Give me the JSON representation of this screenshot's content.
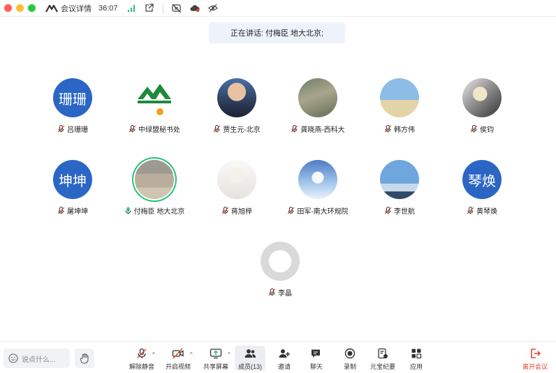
{
  "titlebar": {
    "title": "会议详情",
    "time": "36:07"
  },
  "speaking": "正在讲话: 付梅臣 地大北京;",
  "participants": [
    {
      "name": "吕珊珊",
      "avatar": "text",
      "avatar_text": "珊珊"
    },
    {
      "name": "中绿盟秘书处",
      "avatar": "logo"
    },
    {
      "name": "贾生元-北京",
      "avatar": "photo"
    },
    {
      "name": "龚晓燕-西科大",
      "avatar": "photo"
    },
    {
      "name": "韩方伟",
      "avatar": "photo"
    },
    {
      "name": "侯钧",
      "avatar": "photo"
    },
    {
      "name": "屠坤坤",
      "avatar": "text",
      "avatar_text": "坤坤"
    },
    {
      "name": "付梅臣 地大北京",
      "avatar": "photo",
      "speaking": true
    },
    {
      "name": "蒋旭梓",
      "avatar": "photo"
    },
    {
      "name": "田军-南大环规院",
      "avatar": "photo"
    },
    {
      "name": "李世航",
      "avatar": "photo"
    },
    {
      "name": "黄琴焕",
      "avatar": "text",
      "avatar_text": "琴焕"
    },
    {
      "name": "李晶",
      "avatar": "photo"
    }
  ],
  "toolbar": {
    "chat_placeholder": "说点什么...",
    "unmute": "解除静音",
    "video": "开启视频",
    "share": "共享屏幕",
    "members": "成员(13)",
    "invite": "邀请",
    "chat": "聊天",
    "record": "录制",
    "yuanbao": "元宝纪要",
    "apps": "应用",
    "leave": "离开会议"
  },
  "colors": {
    "avatar_blue": "#2b66c4",
    "speaking_ring": "#27c07a",
    "leave_red": "#e0452d",
    "banner_bg": "#eef3fb"
  }
}
